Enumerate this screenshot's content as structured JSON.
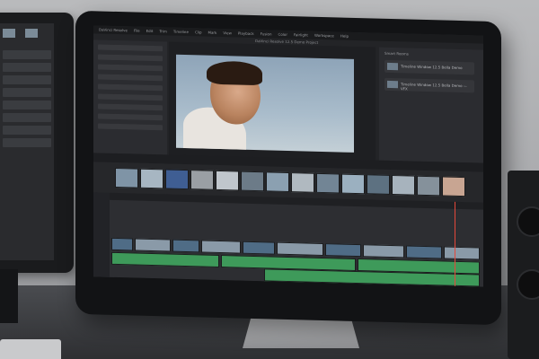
{
  "scene": {
    "description_free": true
  },
  "resolve_ui": {
    "menu_items": [
      "DaVinci Resolve",
      "File",
      "Edit",
      "Trim",
      "Timeline",
      "Clip",
      "Mark",
      "View",
      "Playback",
      "Fusion",
      "Color",
      "Fairlight",
      "Workspace",
      "Help"
    ],
    "title": "DaVinci Resolve 12.5 Demo Project",
    "right_panel_title": "Smart Rooms",
    "right_panel_items": [
      "Timeline Window 12.5 Bella Demo",
      "Timeline Window 12.5 Bella Demo — VFX"
    ]
  },
  "device": {
    "logo_glyph": "",
    "logo_icon": "apple-logo-icon"
  },
  "colors": {
    "video_clip": "#4f6c86",
    "audio_clip": "#3e9a5a",
    "playhead": "#e5483b"
  }
}
